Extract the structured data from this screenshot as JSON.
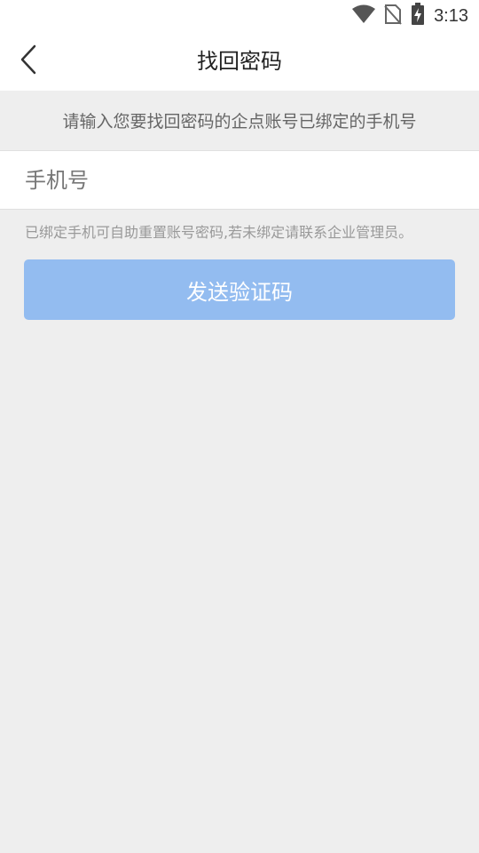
{
  "status_bar": {
    "time": "3:13",
    "icons": [
      "wifi-icon",
      "no-sim-icon",
      "battery-charging-icon"
    ]
  },
  "nav": {
    "title": "找回密码",
    "back_icon": "chevron-left-icon"
  },
  "hint": {
    "text": "请输入您要找回密码的企点账号已绑定的手机号"
  },
  "phone_field": {
    "value": "",
    "placeholder": "手机号"
  },
  "note": {
    "text": "已绑定手机可自助重置账号密码,若未绑定请联系企业管理员。"
  },
  "send_button": {
    "label": "发送验证码"
  },
  "colors": {
    "button_bg": "#93bcf0",
    "page_bg": "#eeeeee",
    "bar_bg": "#ffffff"
  }
}
